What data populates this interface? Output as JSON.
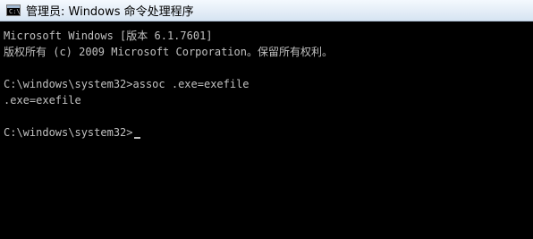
{
  "window": {
    "title": "管理员: Windows 命令处理程序",
    "icon": "cmd-icon",
    "icon_glyph": "C:\\"
  },
  "console": {
    "lines": [
      "Microsoft Windows [版本 6.1.7601]",
      "版权所有 (c) 2009 Microsoft Corporation。保留所有权利。",
      "",
      "C:\\windows\\system32>assoc .exe=exefile",
      ".exe=exefile",
      ""
    ],
    "current_prompt": "C:\\windows\\system32>"
  },
  "colors": {
    "console_background": "#000000",
    "console_text": "#c0c0c0",
    "titlebar": "#e4edf7"
  }
}
